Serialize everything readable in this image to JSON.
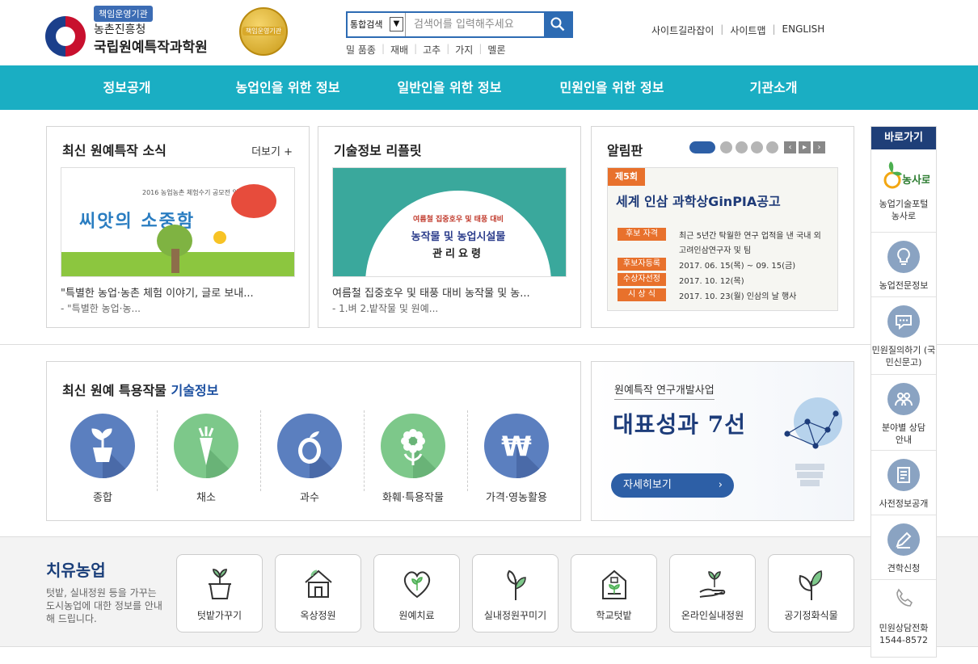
{
  "header": {
    "badge": "책임운영기관",
    "org_line1": "농촌진흥청",
    "org_line2": "국립원예특작과학원",
    "award_text": "책임운영기관",
    "search": {
      "scope": "통합검색",
      "placeholder": "검색어를 입력해주세요"
    },
    "keywords": [
      "밀 품종",
      "재배",
      "고추",
      "가지",
      "멜론"
    ],
    "util_links": [
      "사이트길라잡이",
      "사이트맵",
      "ENGLISH"
    ]
  },
  "nav": [
    "정보공개",
    "농업인을 위한 정보",
    "일반인을 위한 정보",
    "민원인을 위한 정보",
    "기관소개"
  ],
  "news": {
    "title": "최신 원예특작 소식",
    "more": "더보기 +",
    "image_title": "씨앗의 소중함",
    "image_sub": "2016 농업농촌 체험수기 공모전 입상작 모음",
    "caption1": "\"특별한 농업·농촌 체험 이야기, 글로 보내...",
    "caption2": "- \"특별한 농업·농..."
  },
  "leaflet": {
    "title": "기술정보 리플릿",
    "image_line1": "여름철 집중호우 및 태풍 대비",
    "image_line2": "농작물 및 농업시설물",
    "image_line3": "관리요령",
    "caption1": "여름철 집중호우 및 태풍 대비 농작물 및 농...",
    "caption2": "- 1.벼 2.밭작물 및 원예..."
  },
  "notice": {
    "title": "알림판",
    "arrows": [
      "‹",
      "▸",
      "›"
    ],
    "banner_edition": "제5회",
    "banner_title": "세계 인삼 과학상GinPIA공고",
    "rows": [
      {
        "label": "후보 자격",
        "text": "최근 5년간 탁월한 연구 업적을 낸 국내 외"
      },
      {
        "label": "",
        "text": "고려인삼연구자 및 팀"
      },
      {
        "label": "후보자등록",
        "text": "2017. 06. 15(목) ~ 09. 15(금)"
      },
      {
        "label": "수상자선정",
        "text": "2017. 10. 12(목)"
      },
      {
        "label": "시 상 식",
        "text": "2017. 10. 23(월) 인삼의 날 행사"
      }
    ]
  },
  "tech": {
    "title_plain": "최신 원예 특용작물 ",
    "title_highlight": "기술정보",
    "items": [
      {
        "label": "종합",
        "icon": "seedling-pot-icon",
        "color": "#5b7fbf"
      },
      {
        "label": "채소",
        "icon": "carrot-icon",
        "color": "#7dc88a"
      },
      {
        "label": "과수",
        "icon": "fruit-icon",
        "color": "#5b7fbf"
      },
      {
        "label": "화훼·특용작물",
        "icon": "flower-icon",
        "color": "#7dc88a"
      },
      {
        "label": "가격·영농활용",
        "icon": "won-icon",
        "color": "#5b7fbf"
      }
    ]
  },
  "promo": {
    "subtitle": "원예특작 연구개발사업",
    "main": "대표성과 7선",
    "button": "자세히보기"
  },
  "healing": {
    "title": "치유농업",
    "desc": "텃밭, 실내정원 등을 가꾸는 도시농업에 대한 정보를 안내해 드립니다.",
    "items": [
      "텃밭가꾸기",
      "옥상정원",
      "원예치료",
      "실내정원꾸미기",
      "학교텃밭",
      "온라인실내정원",
      "공기정화식물"
    ]
  },
  "quick": {
    "title": "바로가기",
    "items": [
      {
        "label": "농업기술포털 농사로",
        "logo": "농사로"
      },
      {
        "label": "농업전문정보"
      },
      {
        "label": "민원질의하기 (국민신문고)"
      },
      {
        "label": "분야별 상담안내"
      },
      {
        "label": "사전정보공개"
      },
      {
        "label": "견학신청"
      },
      {
        "label": "민원상담전화 1544-8572"
      }
    ]
  },
  "colors": {
    "nav_bg": "#1aaec3",
    "brand_blue": "#2d5fa6",
    "quick_head": "#1f3f78"
  }
}
